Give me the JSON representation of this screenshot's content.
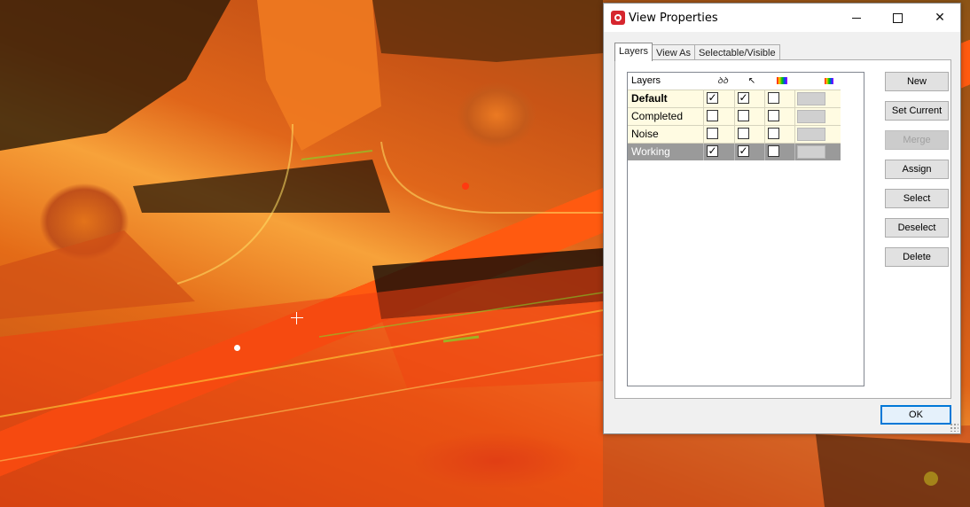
{
  "window": {
    "title": "View Properties",
    "controls": {
      "minimize": "–",
      "maximize": "□",
      "close": "✕"
    }
  },
  "tabs": [
    {
      "label": "Layers",
      "active": true
    },
    {
      "label": "View As",
      "active": false
    },
    {
      "label": "Selectable/Visible",
      "active": false
    }
  ],
  "layers_table": {
    "headers": {
      "name": "Layers",
      "visible_icon": "visibility-icon",
      "selectable_icon": "cursor-icon",
      "color_mode_icon": "color-mode-icon",
      "color_icon": "color-palette-icon"
    },
    "rows": [
      {
        "name": "Default",
        "visible": true,
        "selectable": true,
        "color_mode": false,
        "bold": true,
        "selected": false
      },
      {
        "name": "Completed",
        "visible": false,
        "selectable": false,
        "color_mode": false,
        "bold": false,
        "selected": false
      },
      {
        "name": "Noise",
        "visible": false,
        "selectable": false,
        "color_mode": false,
        "bold": false,
        "selected": false
      },
      {
        "name": "Working",
        "visible": true,
        "selectable": true,
        "color_mode": false,
        "bold": false,
        "selected": true
      }
    ]
  },
  "buttons": {
    "new": "New",
    "set_current": "Set Current",
    "merge": "Merge",
    "assign": "Assign",
    "select": "Select",
    "deselect": "Deselect",
    "delete": "Delete",
    "ok": "OK"
  },
  "colors": {
    "selected_row": "#9a9a9a",
    "row_background": "#fffbe2",
    "app_icon": "#d6262e",
    "default_button_border": "#0078d7"
  }
}
